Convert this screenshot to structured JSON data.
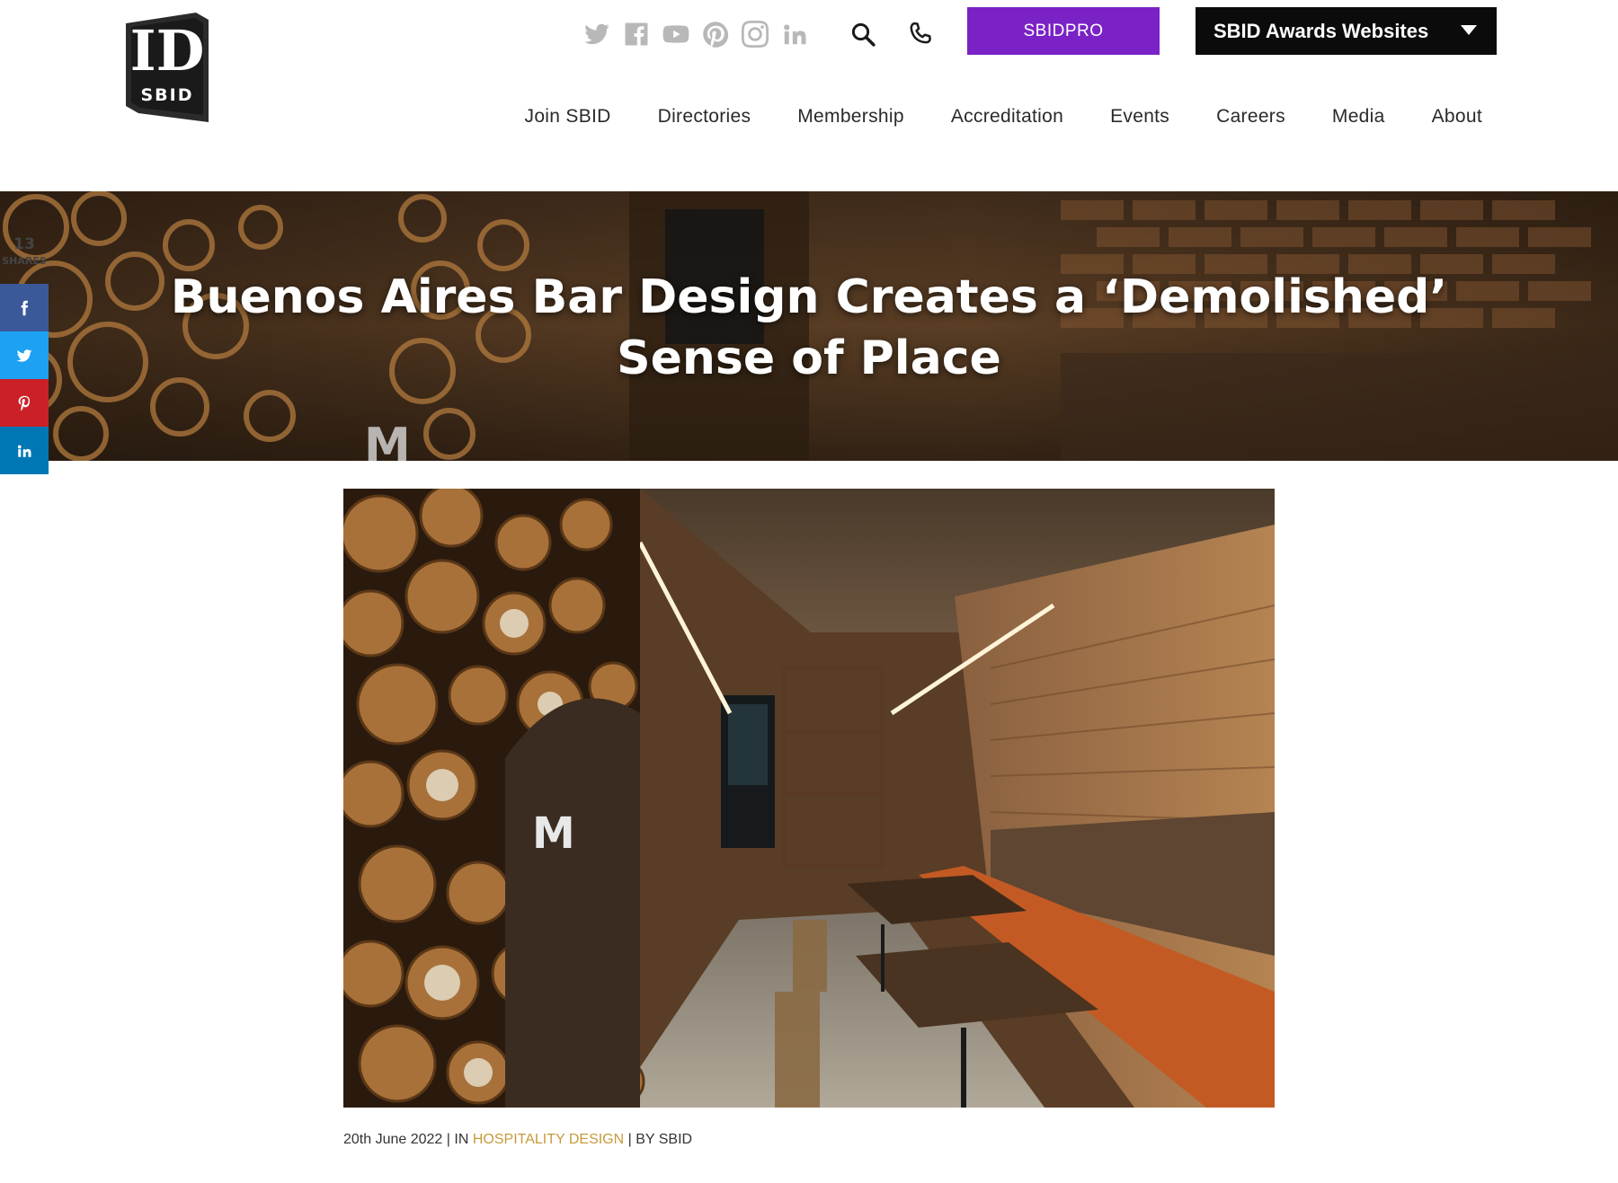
{
  "logo": {
    "letters": "ID",
    "wordmark": "SBID"
  },
  "social": [
    {
      "name": "twitter-icon"
    },
    {
      "name": "facebook-icon"
    },
    {
      "name": "youtube-icon"
    },
    {
      "name": "pinterest-icon"
    },
    {
      "name": "instagram-icon"
    },
    {
      "name": "linkedin-icon"
    }
  ],
  "header": {
    "pro_label": "SBIDPRO",
    "awards_label": "SBID Awards Websites"
  },
  "nav": {
    "items": [
      "Join SBID",
      "Directories",
      "Membership",
      "Accreditation",
      "Events",
      "Careers",
      "Media",
      "About"
    ]
  },
  "hero": {
    "title_line1": "Buenos Aires Bar Design Creates a ‘Demolished’",
    "title_line2": "Sense of Place"
  },
  "share": {
    "count": "13",
    "label": "SHARES",
    "buttons": [
      {
        "name": "facebook",
        "color": "#3b5998"
      },
      {
        "name": "twitter",
        "color": "#1da1f2"
      },
      {
        "name": "pinterest",
        "color": "#cb2027"
      },
      {
        "name": "linkedin",
        "color": "#0077b5"
      }
    ]
  },
  "article": {
    "image_letter": "M",
    "date": "20th June 2022",
    "in_label": "| IN",
    "category": "HOSPITALITY DESIGN",
    "by_label": "| BY SBID"
  },
  "colors": {
    "accent_purple": "#7b22c6",
    "awards_black": "#0b0b0b",
    "category_gold": "#c79a3c",
    "social_grey": "#b8b8b8"
  }
}
